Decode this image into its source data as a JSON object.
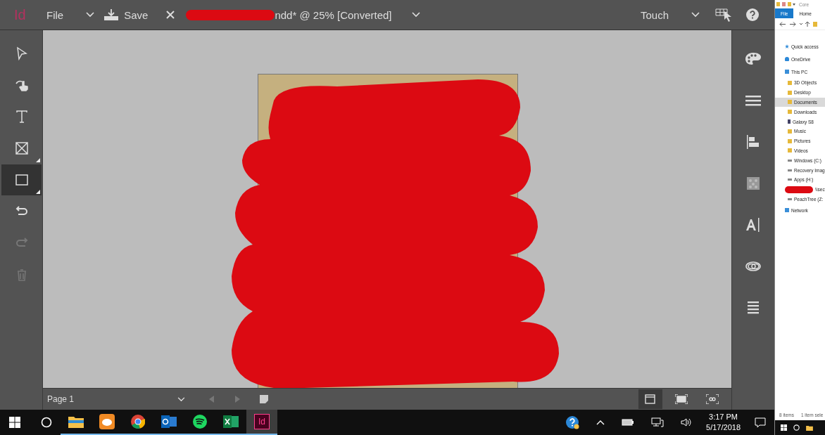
{
  "app": {
    "logo": "Id",
    "menu": "File",
    "save": "Save",
    "document_title": "ndd* @ 25% [Converted]",
    "workspace": "Touch"
  },
  "tools": [
    {
      "kind": "select",
      "selected": false,
      "disabled": false,
      "flyout": false
    },
    {
      "kind": "hand",
      "selected": false,
      "disabled": false,
      "flyout": false
    },
    {
      "kind": "type",
      "selected": false,
      "disabled": false,
      "flyout": false
    },
    {
      "kind": "frame",
      "selected": false,
      "disabled": false,
      "flyout": true
    },
    {
      "kind": "rectangle",
      "selected": true,
      "disabled": false,
      "flyout": true
    },
    {
      "kind": "undo",
      "selected": false,
      "disabled": false,
      "flyout": false
    },
    {
      "kind": "redo",
      "selected": false,
      "disabled": true,
      "flyout": false
    },
    {
      "kind": "delete",
      "selected": false,
      "disabled": true,
      "flyout": false
    }
  ],
  "panels": [
    {
      "kind": "palette"
    },
    {
      "kind": "lines"
    },
    {
      "kind": "align"
    },
    {
      "kind": "swatches"
    },
    {
      "kind": "character"
    },
    {
      "kind": "libraries"
    },
    {
      "kind": "layers"
    }
  ],
  "status_bar": {
    "page": "Page 1",
    "views": [
      {
        "kind": "normal",
        "selected": true
      },
      {
        "kind": "fit",
        "selected": false
      },
      {
        "kind": "presentation",
        "selected": false
      }
    ]
  },
  "taskbar": {
    "apps": [
      {
        "kind": "folder",
        "active": false
      },
      {
        "kind": "launcher",
        "active": false
      },
      {
        "kind": "browser",
        "active": false
      },
      {
        "kind": "mail",
        "active": false
      },
      {
        "kind": "music",
        "active": false
      },
      {
        "kind": "sheet",
        "active": false
      },
      {
        "kind": "indesign",
        "active": true,
        "label": "Id"
      }
    ],
    "time": "3:17 PM",
    "date": "5/17/2018"
  },
  "explorer": {
    "title": "Core",
    "tabs": [
      {
        "label": "File",
        "selected": true
      },
      {
        "label": "Home",
        "selected": false
      }
    ],
    "tree": [
      {
        "label": "Quick access",
        "kind": "star",
        "selected": false
      },
      {
        "label": "OneDrive",
        "kind": "cloud",
        "selected": false
      },
      {
        "label": "This PC",
        "kind": "computer",
        "selected": false,
        "children": [
          {
            "label": "3D Objects",
            "kind": "folder",
            "selected": false
          },
          {
            "label": "Desktop",
            "kind": "folder",
            "selected": false
          },
          {
            "label": "Documents",
            "kind": "folder",
            "selected": true
          },
          {
            "label": "Downloads",
            "kind": "folder",
            "selected": false
          },
          {
            "label": "Galaxy S8",
            "kind": "phone",
            "selected": false
          },
          {
            "label": "Music",
            "kind": "folder",
            "selected": false
          },
          {
            "label": "Pictures",
            "kind": "folder",
            "selected": false
          },
          {
            "label": "Videos",
            "kind": "folder",
            "selected": false
          },
          {
            "label": "Windows (C:)",
            "kind": "drive",
            "selected": false
          },
          {
            "label": "Recovery Imag",
            "kind": "drive",
            "selected": false
          },
          {
            "label": "Apps (H:)",
            "kind": "drive",
            "selected": false
          },
          {
            "label": "\\\\sec",
            "kind": "redacted",
            "selected": false
          },
          {
            "label": "PeachTree (Z:",
            "kind": "drive",
            "selected": false
          }
        ]
      },
      {
        "label": "Network",
        "kind": "network",
        "selected": false
      }
    ],
    "status": [
      "8 items",
      "1 item sele"
    ]
  }
}
